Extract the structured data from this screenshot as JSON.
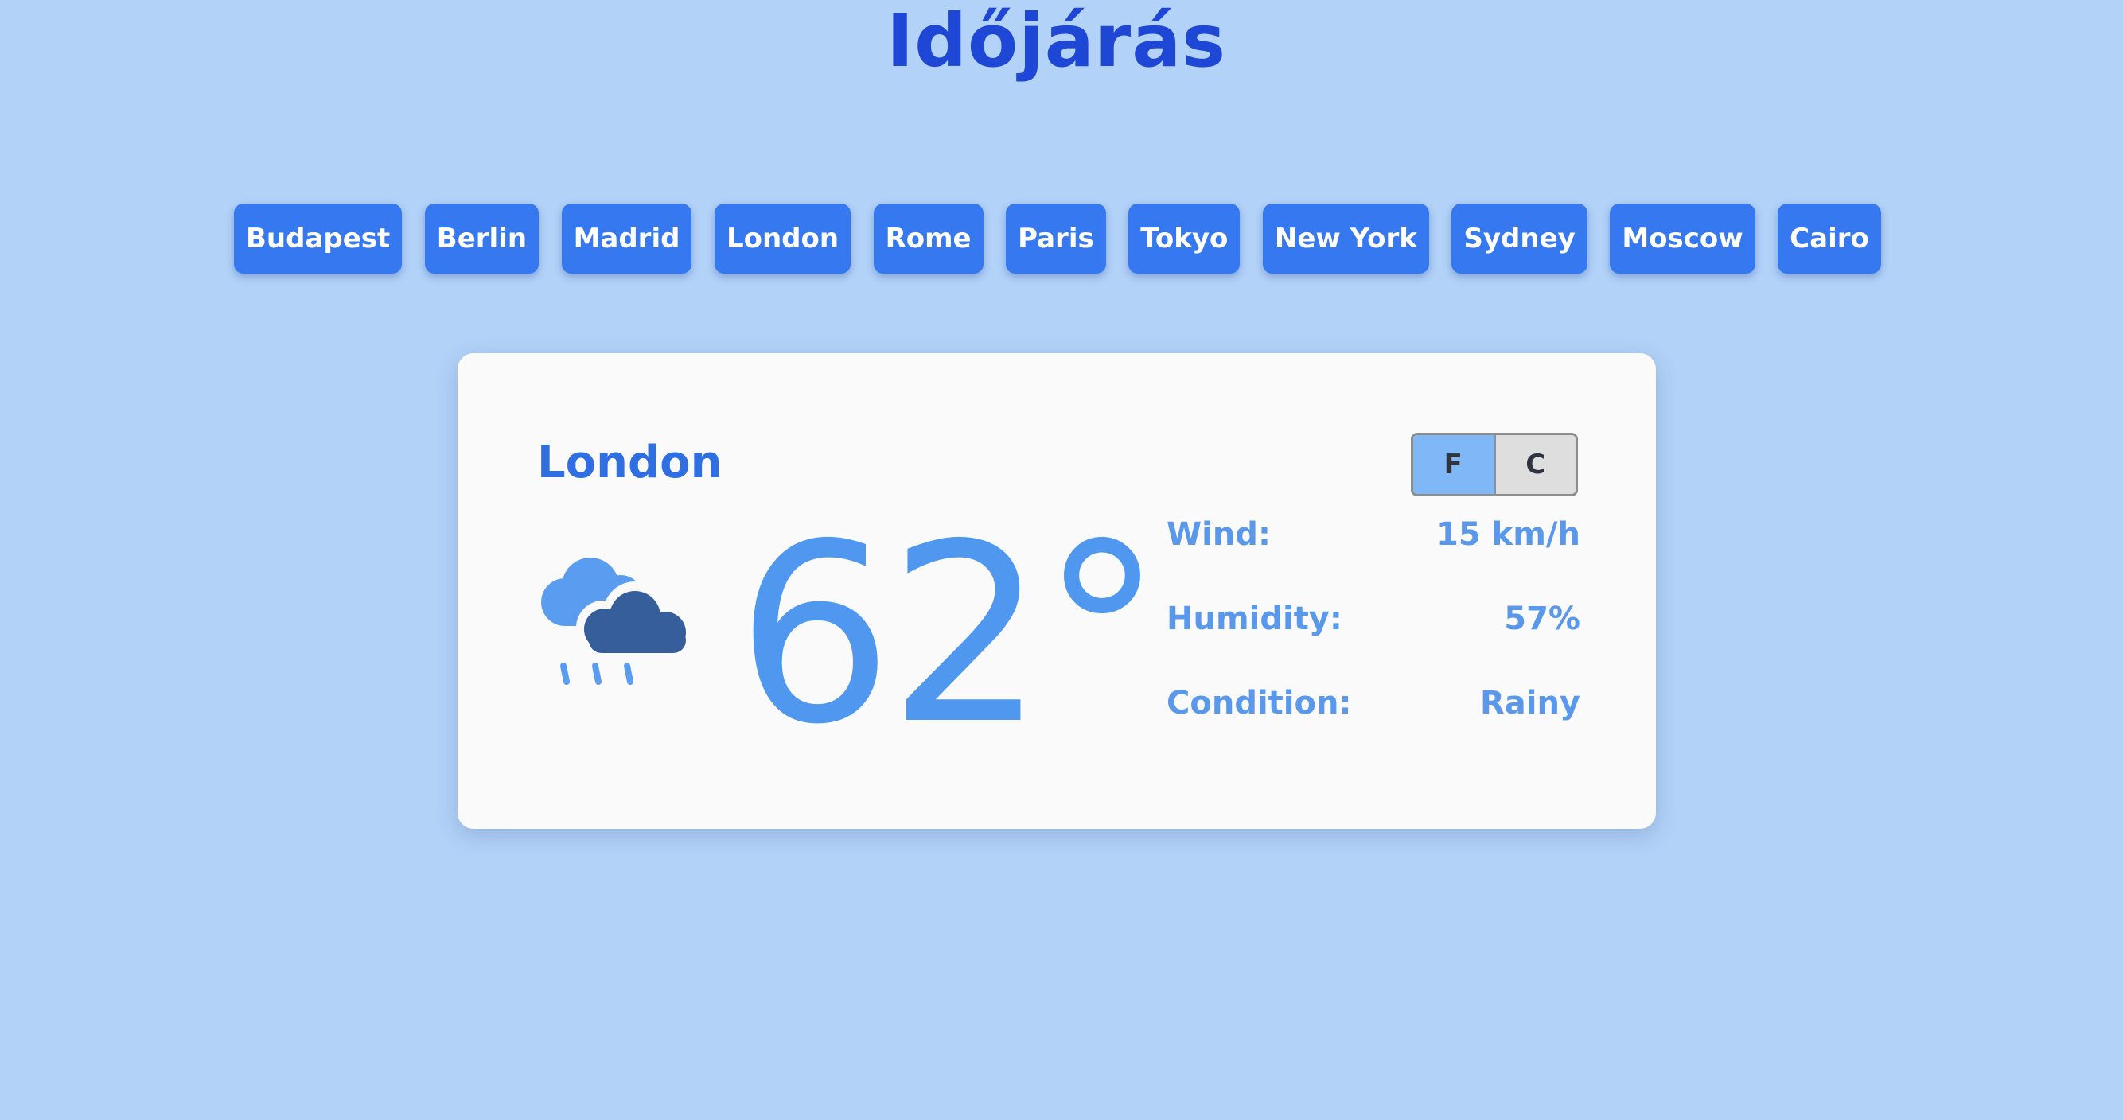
{
  "header": {
    "title": "Időjárás"
  },
  "cities": [
    "Budapest",
    "Berlin",
    "Madrid",
    "London",
    "Rome",
    "Paris",
    "Tokyo",
    "New York",
    "Sydney",
    "Moscow",
    "Cairo"
  ],
  "weather": {
    "city": "London",
    "temperature": "62°",
    "icon": "rain-cloud-icon",
    "units": {
      "f_label": "F",
      "c_label": "C",
      "selected": "F"
    },
    "details": [
      {
        "label": "Wind:",
        "value": "15 km/h"
      },
      {
        "label": "Humidity:",
        "value": "57%"
      },
      {
        "label": "Condition:",
        "value": "Rainy"
      }
    ]
  },
  "colors": {
    "background": "#b2d2f8",
    "title": "#1f47d6",
    "button": "#3578ef",
    "accent": "#5098ef",
    "card": "#fafafa"
  }
}
